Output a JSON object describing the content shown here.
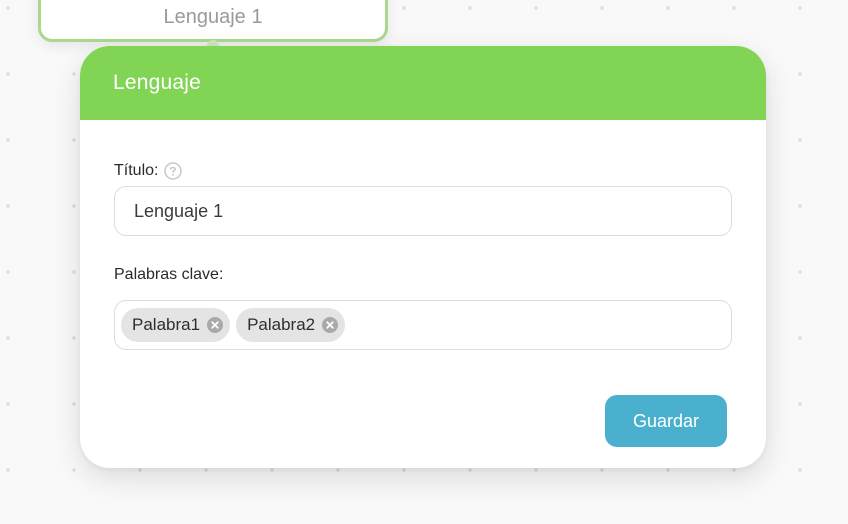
{
  "background_node": {
    "label": "Lenguaje 1"
  },
  "modal": {
    "title": "Lenguaje",
    "title_field": {
      "label": "Título:",
      "value": "Lenguaje 1"
    },
    "keywords_field": {
      "label": "Palabras clave:",
      "chips": [
        {
          "label": "Palabra1"
        },
        {
          "label": "Palabra2"
        }
      ]
    },
    "save_label": "Guardar"
  },
  "colors": {
    "header": "#82d455",
    "button": "#4ab0ce",
    "background_node_border": "#a9d98e"
  },
  "icons": {
    "help": "question-circle-icon",
    "chip_remove": "close-circle-icon"
  }
}
